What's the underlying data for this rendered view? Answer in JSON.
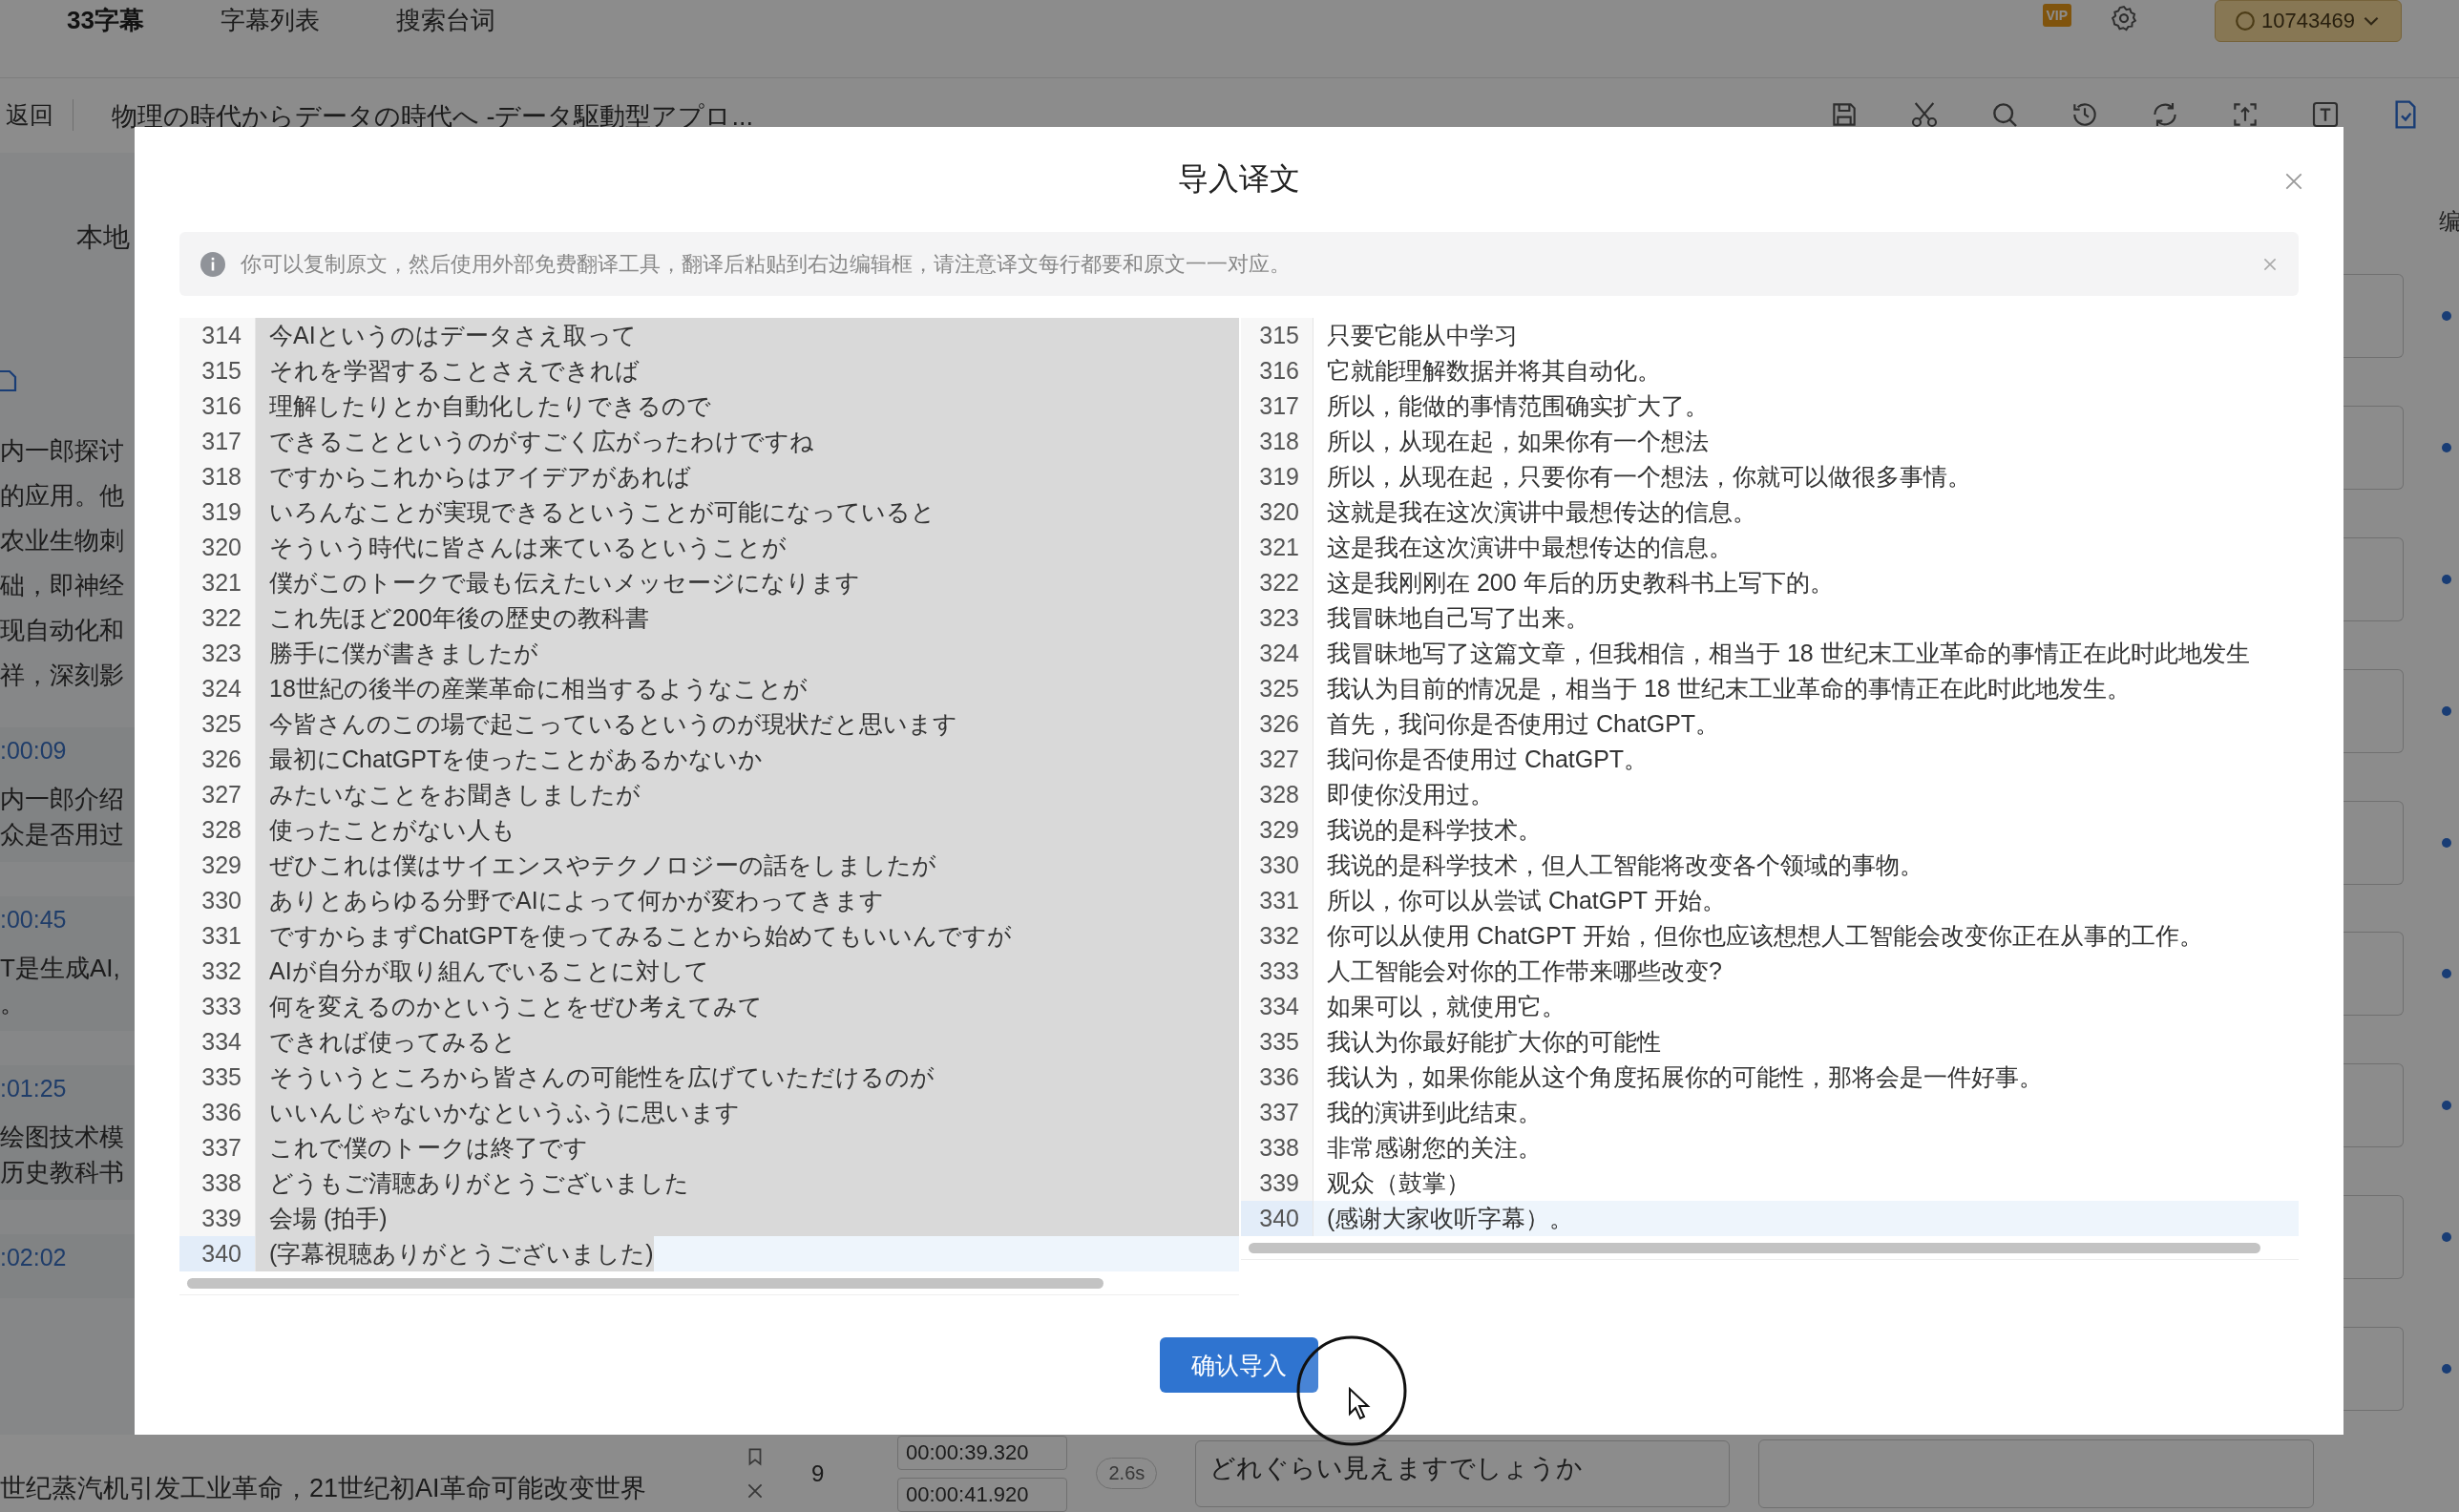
{
  "top_nav": {
    "brand": "33字幕",
    "links": [
      {
        "label": "字幕列表"
      },
      {
        "label": "搜索台词"
      }
    ],
    "badge": "VIP",
    "account": "10743469"
  },
  "sub_bar": {
    "back": "返回",
    "title": "物理の時代からデータの時代へ -データ駆動型アプロ..."
  },
  "side_panel": {
    "tab": "本地",
    "summary_lines": [
      "内一郎探讨",
      "的应用。他",
      "农业生物刺",
      "础，即神经",
      "现自动化和",
      "祥，深刻影"
    ],
    "entries": [
      {
        "time": ":00:09",
        "lines": [
          "内一郎介绍",
          "众是否用过"
        ]
      },
      {
        "time": ":00:45",
        "lines": [
          "T是生成AI,",
          "。"
        ]
      },
      {
        "time": ":01:25",
        "lines": [
          "绘图技术模",
          "历史教科书"
        ]
      },
      {
        "time": ":02:02"
      }
    ]
  },
  "right_panel": {
    "label": "编"
  },
  "bottom_row": {
    "summary": "世纪蒸汽机引发工业革命，21世纪初AI革命可能改变世界",
    "index": "9",
    "start": "00:00:39.320",
    "end": "00:00:41.920",
    "duration": "2.6s",
    "text": "どれぐらい見えますでしょうか"
  },
  "dialog": {
    "title": "导入译文",
    "notice": "你可以复制原文，然后使用外部免费翻译工具，翻译后粘贴到右边编辑框，请注意译文每行都要和原文一一对应。",
    "source": {
      "text_highlighted": true,
      "lines": [
        {
          "number": "314",
          "text": "今AIというのはデータさえ取って",
          "selected": false
        },
        {
          "number": "315",
          "text": "それを学習することさえできれば",
          "selected": false
        },
        {
          "number": "316",
          "text": "理解したりとか自動化したりできるので",
          "selected": false
        },
        {
          "number": "317",
          "text": "できることというのがすごく広がったわけですね",
          "selected": false
        },
        {
          "number": "318",
          "text": "ですからこれからはアイデアがあれば",
          "selected": false
        },
        {
          "number": "319",
          "text": "いろんなことが実現できるということが可能になっていると",
          "selected": false
        },
        {
          "number": "320",
          "text": "そういう時代に皆さんは来ているということが",
          "selected": false
        },
        {
          "number": "321",
          "text": "僕がこのトークで最も伝えたいメッセージになります",
          "selected": false
        },
        {
          "number": "322",
          "text": "これ先ほど200年後の歴史の教科書",
          "selected": false
        },
        {
          "number": "323",
          "text": "勝手に僕が書きましたが",
          "selected": false
        },
        {
          "number": "324",
          "text": "18世紀の後半の産業革命に相当するようなことが",
          "selected": false
        },
        {
          "number": "325",
          "text": "今皆さんのこの場で起こっているというのが現状だと思います",
          "selected": false
        },
        {
          "number": "326",
          "text": "最初にChatGPTを使ったことがあるかないか",
          "selected": false
        },
        {
          "number": "327",
          "text": "みたいなことをお聞きしましたが",
          "selected": false
        },
        {
          "number": "328",
          "text": "使ったことがない人も",
          "selected": false
        },
        {
          "number": "329",
          "text": "ぜひこれは僕はサイエンスやテクノロジーの話をしましたが",
          "selected": false
        },
        {
          "number": "330",
          "text": "ありとあらゆる分野でAIによって何かが変わってきます",
          "selected": false
        },
        {
          "number": "331",
          "text": "ですからまずChatGPTを使ってみることから始めてもいいんですが",
          "selected": false
        },
        {
          "number": "332",
          "text": "AIが自分が取り組んでいることに対して",
          "selected": false
        },
        {
          "number": "333",
          "text": "何を変えるのかということをぜひ考えてみて",
          "selected": false
        },
        {
          "number": "334",
          "text": "できれば使ってみると",
          "selected": false
        },
        {
          "number": "335",
          "text": "そういうところから皆さんの可能性を広げていただけるのが",
          "selected": false
        },
        {
          "number": "336",
          "text": "いいんじゃないかなというふうに思います",
          "selected": false
        },
        {
          "number": "337",
          "text": "これで僕のトークは終了です",
          "selected": false
        },
        {
          "number": "338",
          "text": "どうもご清聴ありがとうございました",
          "selected": false
        },
        {
          "number": "339",
          "text": "会場 (拍手)",
          "selected": false
        },
        {
          "number": "340",
          "text": "(字幕視聴ありがとうございました)",
          "selected": true
        }
      ]
    },
    "target": {
      "text_highlighted": false,
      "lines": [
        {
          "number": "315",
          "text": "只要它能从中学习",
          "selected": false
        },
        {
          "number": "316",
          "text": "它就能理解数据并将其自动化。",
          "selected": false
        },
        {
          "number": "317",
          "text": "所以，能做的事情范围确实扩大了。",
          "selected": false
        },
        {
          "number": "318",
          "text": "所以，从现在起，如果你有一个想法",
          "selected": false
        },
        {
          "number": "319",
          "text": "所以，从现在起，只要你有一个想法，你就可以做很多事情。",
          "selected": false
        },
        {
          "number": "320",
          "text": "这就是我在这次演讲中最想传达的信息。",
          "selected": false
        },
        {
          "number": "321",
          "text": "这是我在这次演讲中最想传达的信息。",
          "selected": false
        },
        {
          "number": "322",
          "text": "这是我刚刚在 200 年后的历史教科书上写下的。",
          "selected": false
        },
        {
          "number": "323",
          "text": "我冒昧地自己写了出来。",
          "selected": false
        },
        {
          "number": "324",
          "text": "我冒昧地写了这篇文章，但我相信，相当于 18 世纪末工业革命的事情正在此时此地发生",
          "selected": false
        },
        {
          "number": "325",
          "text": "我认为目前的情况是，相当于 18 世纪末工业革命的事情正在此时此地发生。",
          "selected": false
        },
        {
          "number": "326",
          "text": "首先，我问你是否使用过 ChatGPT。",
          "selected": false
        },
        {
          "number": "327",
          "text": "我问你是否使用过 ChatGPT。",
          "selected": false
        },
        {
          "number": "328",
          "text": "即使你没用过。",
          "selected": false
        },
        {
          "number": "329",
          "text": "我说的是科学技术。",
          "selected": false
        },
        {
          "number": "330",
          "text": "我说的是科学技术，但人工智能将改变各个领域的事物。",
          "selected": false
        },
        {
          "number": "331",
          "text": "所以，你可以从尝试 ChatGPT 开始。",
          "selected": false
        },
        {
          "number": "332",
          "text": "你可以从使用 ChatGPT 开始，但你也应该想想人工智能会改变你正在从事的工作。",
          "selected": false
        },
        {
          "number": "333",
          "text": "人工智能会对你的工作带来哪些改变?",
          "selected": false
        },
        {
          "number": "334",
          "text": "如果可以，就使用它。",
          "selected": false
        },
        {
          "number": "335",
          "text": "我认为你最好能扩大你的可能性",
          "selected": false
        },
        {
          "number": "336",
          "text": "我认为，如果你能从这个角度拓展你的可能性，那将会是一件好事。",
          "selected": false
        },
        {
          "number": "337",
          "text": "我的演讲到此结束。",
          "selected": false
        },
        {
          "number": "338",
          "text": "非常感谢您的关注。",
          "selected": false
        },
        {
          "number": "339",
          "text": "观众（鼓掌）",
          "selected": false
        },
        {
          "number": "340",
          "text": "(感谢大家收听字幕）。",
          "selected": true
        }
      ]
    },
    "confirm": "确认导入"
  }
}
